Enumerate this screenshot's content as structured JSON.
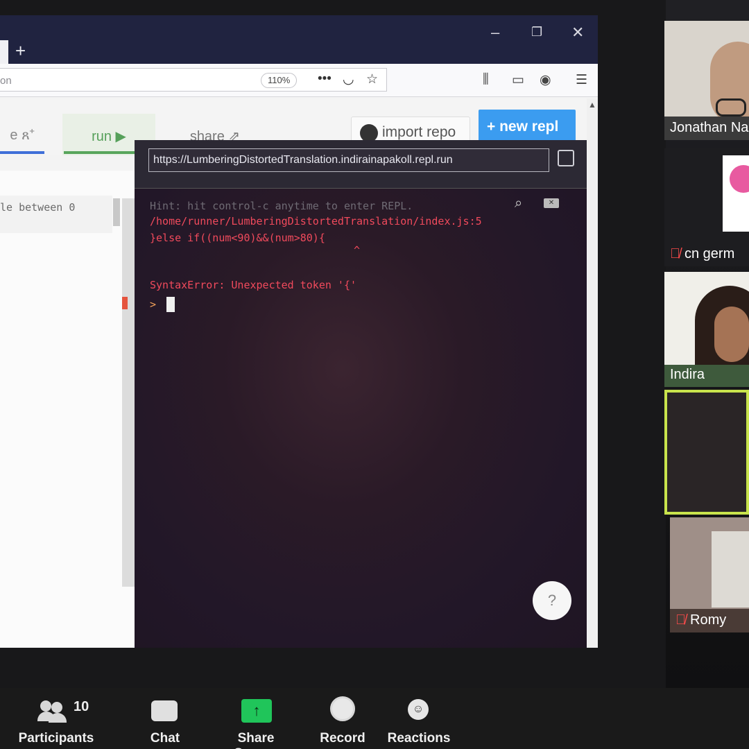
{
  "browser": {
    "url_partial": "on",
    "zoom": "110%",
    "new_tab": "+",
    "window_controls": {
      "minimize": "–",
      "maximize": "❐",
      "close": "✕"
    }
  },
  "repl": {
    "invite_label": "e",
    "run_label": "run ▶",
    "share_label": "share",
    "import_label": "import repo",
    "new_repl_label": "+ new repl",
    "editor_line": "le between 0",
    "console_url": "https://LumberingDistortedTranslation.indirainapakoll.repl.run",
    "hint": "Hint: hit control-c anytime to enter REPL.",
    "error_path": "/home/runner/LumberingDistortedTranslation/index.js:5",
    "error_code": "}else if((num<90)&&(num>80){",
    "caret": "^",
    "syntax_error": "SyntaxError: Unexpected token '{'",
    "prompt": ">",
    "help_label": "?"
  },
  "colors": {
    "tabbar": "#202340",
    "new_repl": "#3b9cf0",
    "run_green": "#56a05a",
    "error_red": "#f14a5c",
    "active_speaker": "#c8e34c"
  },
  "icons": [
    "library-icon",
    "sidebar-icon",
    "account-icon",
    "menu-icon",
    "more-icon",
    "pocket-icon",
    "bookmark-star-icon",
    "github-icon",
    "share-icon",
    "open-external-icon",
    "search-icon",
    "clear-icon"
  ],
  "gallery": {
    "participants": [
      {
        "name": "Jonathan Na",
        "muted": false
      },
      {
        "name": "cn germ",
        "muted": true
      },
      {
        "name": "Indira",
        "muted": false
      },
      {
        "name": "",
        "muted": false
      },
      {
        "name": "Romy",
        "muted": true
      }
    ]
  },
  "toolbar": {
    "participants_label": "Participants",
    "participants_count": "10",
    "chat_label": "Chat",
    "share_label": "Share Screen",
    "record_label": "Record",
    "reactions_label": "Reactions"
  }
}
